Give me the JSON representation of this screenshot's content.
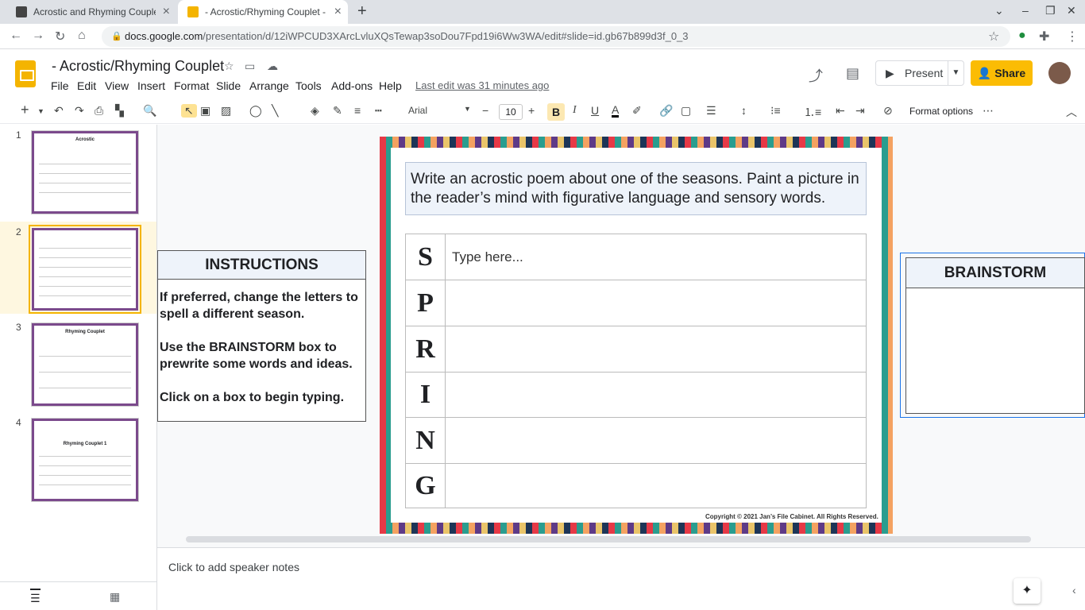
{
  "tabs": [
    {
      "label": "Acrostic and Rhyming Couplet F",
      "active": false
    },
    {
      "label": "- Acrostic/Rhyming Couplet - Go",
      "active": true
    }
  ],
  "address": {
    "host": "docs.google.com",
    "path": "/presentation/d/12iWPCUD3XArcLvluXQsTewap3soDou7Fpd19i6Ww3WA/edit#slide=id.gb67b899d3f_0_3"
  },
  "doc": {
    "title": "- Acrostic/Rhyming Couplet",
    "last_edit": "Last edit was 31 minutes ago"
  },
  "menu": [
    "File",
    "Edit",
    "View",
    "Insert",
    "Format",
    "Slide",
    "Arrange",
    "Tools",
    "Add-ons",
    "Help"
  ],
  "header": {
    "present_label": "Present",
    "share_label": "Share"
  },
  "toolbar": {
    "font": "Arial",
    "font_size": "10",
    "bold": "B",
    "format_options": "Format options"
  },
  "filmstrip": {
    "numbers": [
      "1",
      "2",
      "3",
      "4"
    ],
    "thumb_titles": [
      "Acrostic",
      "",
      "Rhyming Couplet",
      "Rhyming Couplet 1"
    ]
  },
  "slide": {
    "prompt": "Write an acrostic poem about one of the seasons. Paint a picture in the reader’s mind with figurative language and sensory words.",
    "letters": [
      "S",
      "P",
      "R",
      "I",
      "N",
      "G"
    ],
    "placeholder": "Type here...",
    "copyright": "Copyright © 2021 Jan’s File Cabinet. All Rights Reserved."
  },
  "instructions": {
    "title": "INSTRUCTIONS",
    "lines": [
      "If preferred, change the letters to spell a different season.",
      "Use the BRAINSTORM box to prewrite some words and ideas.",
      "Click on a box to begin typing."
    ]
  },
  "brainstorm": {
    "title": "BRAINSTORM"
  },
  "notes": {
    "placeholder": "Click to add speaker notes"
  },
  "colors": {
    "share": "#fbbc04",
    "slides_logo": "#f4b400",
    "selected_thumb_bg": "#fef7e0"
  }
}
